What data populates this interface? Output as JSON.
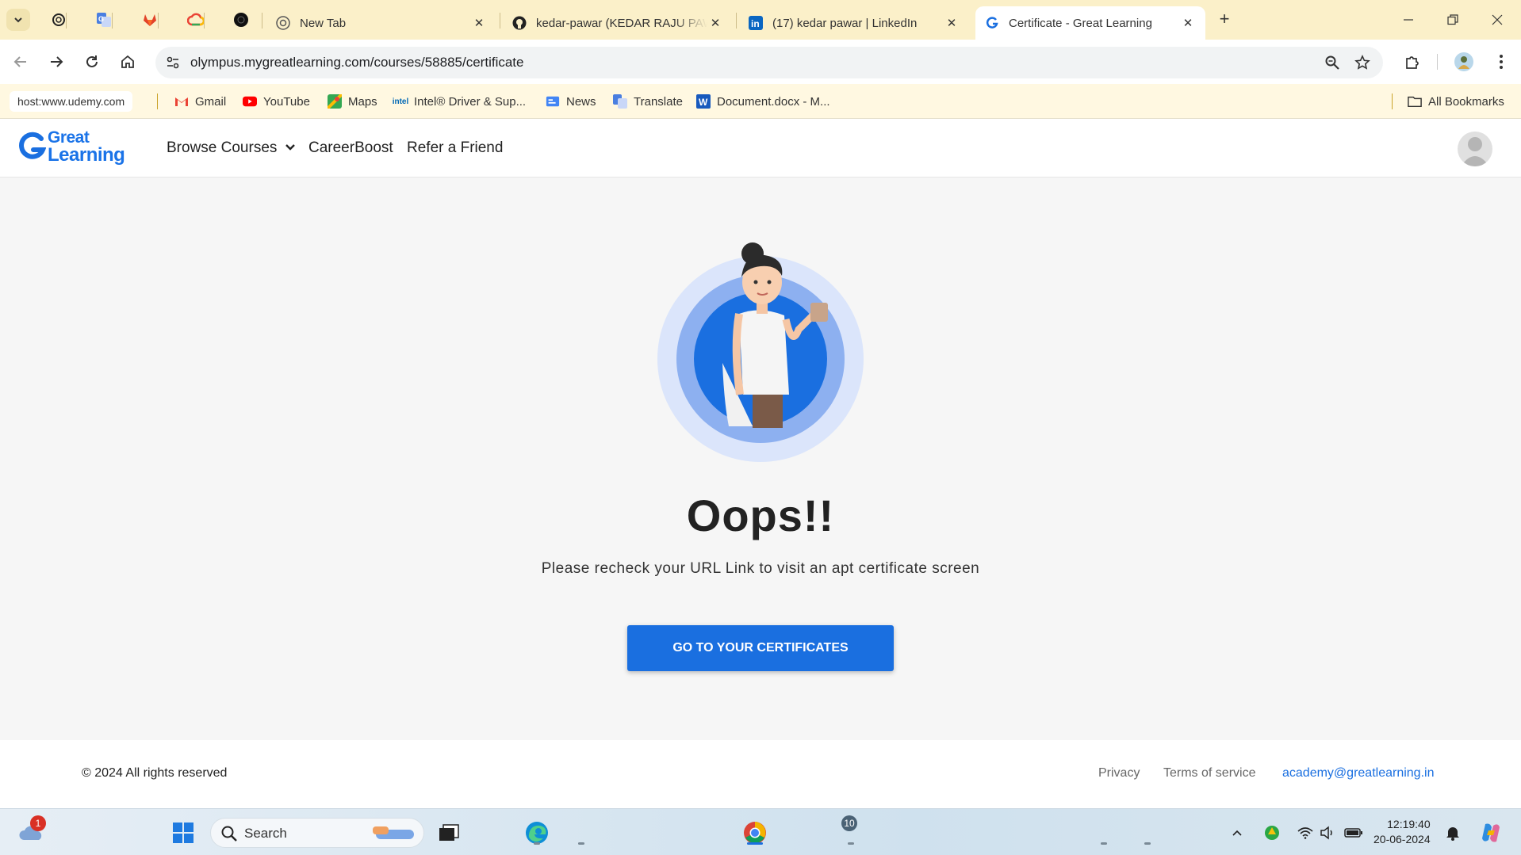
{
  "browser": {
    "tabs": [
      {
        "title": "New Tab",
        "active": false
      },
      {
        "title": "kedar-pawar (KEDAR RAJU PAWAR)",
        "active": false
      },
      {
        "title": "(17) kedar pawar | LinkedIn",
        "active": false
      },
      {
        "title": "Certificate - Great Learning",
        "active": true
      }
    ],
    "url": "olympus.mygreatlearning.com/courses/58885/certificate",
    "bookmarks": {
      "host_chip": "host:www.udemy.com",
      "items": [
        "Gmail",
        "YouTube",
        "Maps",
        "Intel® Driver & Sup...",
        "News",
        "Translate",
        "Document.docx - M..."
      ],
      "all_bookmarks": "All Bookmarks"
    }
  },
  "site": {
    "logo_line1": "Great",
    "logo_line2": "Learning",
    "nav": {
      "browse": "Browse Courses",
      "careerboost": "CareerBoost",
      "refer": "Refer a Friend"
    }
  },
  "error": {
    "title": "Oops!!",
    "message": "Please recheck your URL Link to visit an apt certificate screen",
    "cta": "GO TO YOUR CERTIFICATES"
  },
  "footer": {
    "copyright": "© 2024 All rights reserved",
    "privacy": "Privacy",
    "terms": "Terms of service",
    "email": "academy@greatlearning.in"
  },
  "taskbar": {
    "search_label": "Search",
    "weather_badge": "1",
    "app_badge": "10",
    "time": "12:19:40",
    "date": "20-06-2024"
  },
  "colors": {
    "brand_blue": "#1a6fe0",
    "tabstrip": "#fbf0c9",
    "bookmarks_bar": "#fff8e1"
  }
}
